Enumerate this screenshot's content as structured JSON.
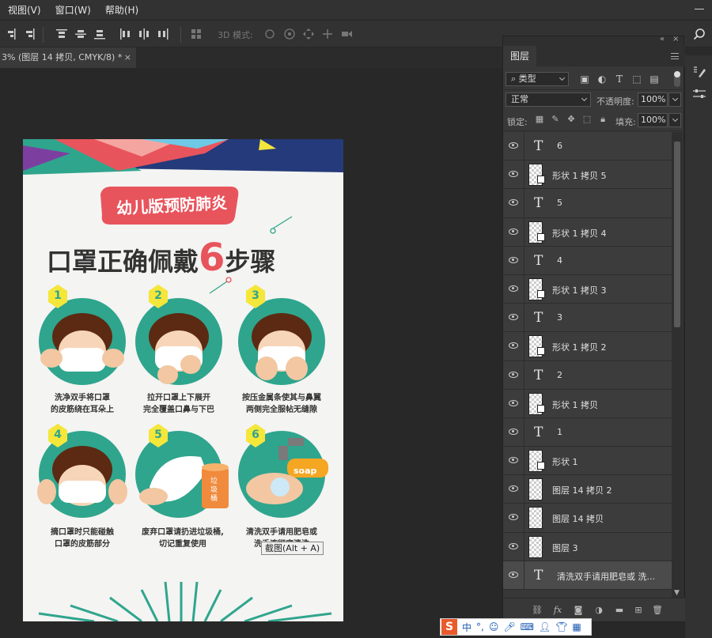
{
  "menubar": {
    "items": [
      "视图(V)",
      "窗口(W)",
      "帮助(H)"
    ]
  },
  "options_bar": {
    "mode_label": "3D 模式:"
  },
  "document_tab": {
    "title": "3% (图层 14 拷贝, CMYK/8) *",
    "close": "×"
  },
  "poster": {
    "badge_text": "幼儿版预防肺炎",
    "title_left": "口罩正确佩戴",
    "title_number": "6",
    "title_right": "步骤",
    "steps": [
      {
        "num": "1",
        "line1": "洗净双手将口罩",
        "line2": "的皮筋绕在耳朵上"
      },
      {
        "num": "2",
        "line1": "拉开口罩上下展开",
        "line2": "完全覆盖口鼻与下巴"
      },
      {
        "num": "3",
        "line1": "按压金属条使其与鼻翼",
        "line2": "两侧完全服帖无缝隙"
      },
      {
        "num": "4",
        "line1": "摘口罩时只能碰触",
        "line2": "口罩的皮筋部分"
      },
      {
        "num": "5",
        "line1": "废弃口罩请扔进垃圾桶,",
        "line2": "切记重复使用"
      },
      {
        "num": "6",
        "line1": "清洗双手请用肥皂或",
        "line2": "洗手液彻底清洗"
      }
    ],
    "soap_label": "soap",
    "bin_label": "垃圾桶"
  },
  "tooltip": "截图(Alt + A)",
  "panel": {
    "collapse": "«",
    "close": "×",
    "tab_label": "图层",
    "filter_kind": "类型",
    "blend_mode": "正常",
    "opacity_label": "不透明度:",
    "opacity_value": "100%",
    "lock_label": "锁定:",
    "fill_label": "填充:",
    "fill_value": "100%",
    "layers": [
      {
        "type": "text",
        "name": "6"
      },
      {
        "type": "shape",
        "name": "形状 1 拷贝 5"
      },
      {
        "type": "text",
        "name": "5"
      },
      {
        "type": "shape",
        "name": "形状 1 拷贝 4"
      },
      {
        "type": "text",
        "name": "4"
      },
      {
        "type": "shape",
        "name": "形状 1 拷贝 3"
      },
      {
        "type": "text",
        "name": "3"
      },
      {
        "type": "shape",
        "name": "形状 1 拷贝 2"
      },
      {
        "type": "text",
        "name": "2"
      },
      {
        "type": "shape",
        "name": "形状 1 拷贝"
      },
      {
        "type": "text",
        "name": "1"
      },
      {
        "type": "shape",
        "name": "形状 1"
      },
      {
        "type": "pixel",
        "name": "图层 14 拷贝 2"
      },
      {
        "type": "pixel",
        "name": "图层 14 拷贝"
      },
      {
        "type": "pixel",
        "name": "图层 3"
      },
      {
        "type": "text",
        "name": "清洗双手请用肥皂或 洗...",
        "active": true
      }
    ]
  },
  "ime": {
    "logo": "S",
    "lang": "中"
  },
  "colors": {
    "accent_teal": "#2fa58d",
    "accent_red": "#e8545c",
    "badge_yellow": "#f5e63a"
  }
}
